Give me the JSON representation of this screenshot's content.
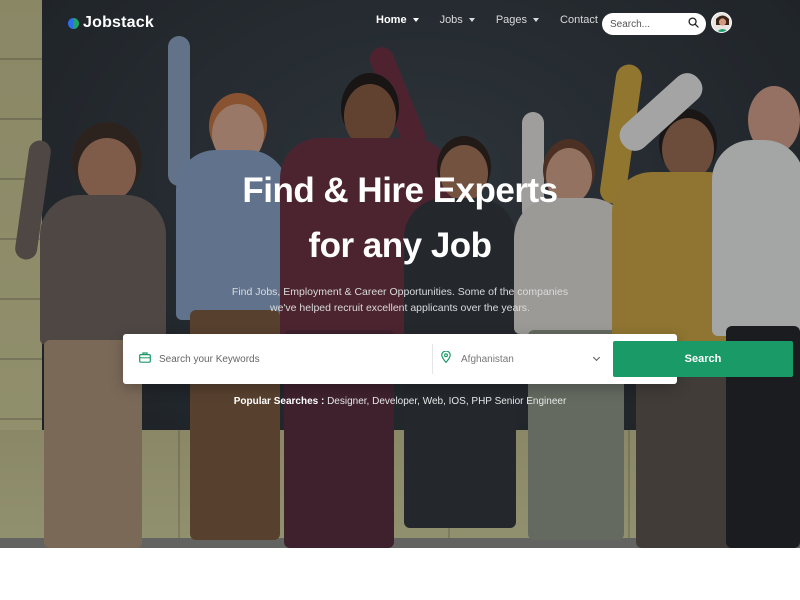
{
  "brand": {
    "name": "Jobstack"
  },
  "nav": {
    "items": [
      {
        "label": "Home",
        "active": true,
        "dropdown": true
      },
      {
        "label": "Jobs",
        "active": false,
        "dropdown": true
      },
      {
        "label": "Pages",
        "active": false,
        "dropdown": true
      },
      {
        "label": "Contact",
        "active": false,
        "dropdown": false
      }
    ],
    "search_placeholder": "Search...",
    "icons": {
      "search": "search-icon",
      "avatar": "user-avatar"
    }
  },
  "hero": {
    "headline_line1": "Find & Hire Experts",
    "headline_line2": "for any Job",
    "subtitle": "Find Jobs, Employment & Career Opportunities. Some of the companies we've helped recruit excellent applicants over the years."
  },
  "search": {
    "keyword_placeholder": "Search your Keywords",
    "location_value": "Afghanistan",
    "button_label": "Search",
    "icons": {
      "keyword": "briefcase-icon",
      "location": "map-pin-icon",
      "dropdown": "chevron-down-icon"
    }
  },
  "popular": {
    "label": "Popular Searches :",
    "terms": "Designer, Developer, Web, IOS, PHP Senior Engineer"
  },
  "colors": {
    "accent": "#1a9a67",
    "brand_dot_green": "#1fa36a",
    "brand_dot_blue": "#2f6cf0"
  }
}
